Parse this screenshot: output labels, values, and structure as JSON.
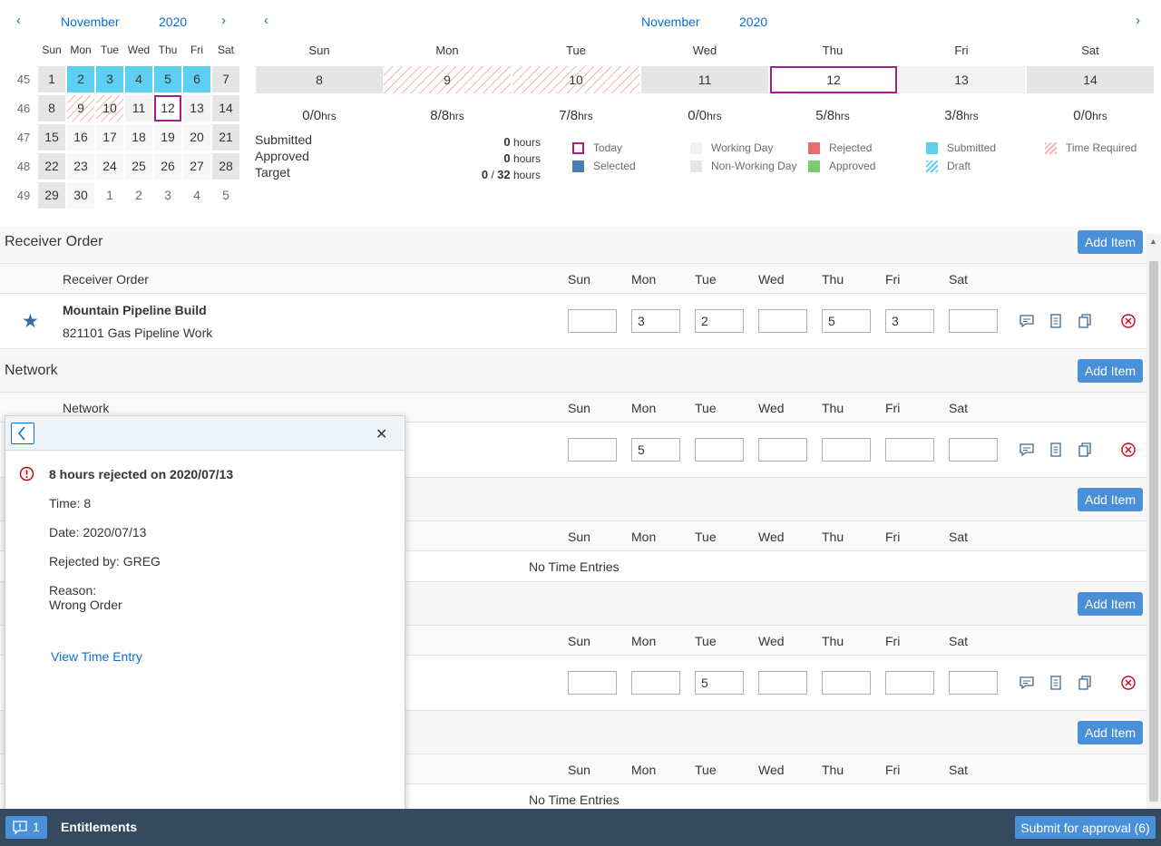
{
  "mini_calendar": {
    "month": "November",
    "year": "2020",
    "weekdays": [
      "Sun",
      "Mon",
      "Tue",
      "Wed",
      "Thu",
      "Fri",
      "Sat"
    ],
    "weeks": [
      {
        "wk": "45",
        "days": [
          "1",
          "2",
          "3",
          "4",
          "5",
          "6",
          "7"
        ]
      },
      {
        "wk": "46",
        "days": [
          "8",
          "9",
          "10",
          "11",
          "12",
          "13",
          "14"
        ]
      },
      {
        "wk": "47",
        "days": [
          "15",
          "16",
          "17",
          "18",
          "19",
          "20",
          "21"
        ]
      },
      {
        "wk": "48",
        "days": [
          "22",
          "23",
          "24",
          "25",
          "26",
          "27",
          "28"
        ]
      },
      {
        "wk": "49",
        "days": [
          "29",
          "30",
          "1",
          "2",
          "3",
          "4",
          "5"
        ]
      }
    ]
  },
  "week_view": {
    "month": "November",
    "year": "2020",
    "days": [
      {
        "dow": "Sun",
        "date": "8",
        "hrs": "0/0"
      },
      {
        "dow": "Mon",
        "date": "9",
        "hrs": "8/8"
      },
      {
        "dow": "Tue",
        "date": "10",
        "hrs": "7/8"
      },
      {
        "dow": "Wed",
        "date": "11",
        "hrs": "0/0"
      },
      {
        "dow": "Thu",
        "date": "12",
        "hrs": "5/8"
      },
      {
        "dow": "Fri",
        "date": "13",
        "hrs": "3/8"
      },
      {
        "dow": "Sat",
        "date": "14",
        "hrs": "0/0"
      }
    ],
    "hrs_unit": "hrs"
  },
  "summary": {
    "submitted_label": "Submitted",
    "submitted_value": "0",
    "submitted_unit": "hours",
    "approved_label": "Approved",
    "approved_value": "0",
    "approved_unit": "hours",
    "target_label": "Target",
    "target_value": "0",
    "target_sep": " / ",
    "target_total": "32",
    "target_unit": "hours"
  },
  "legend": {
    "today": "Today",
    "selected": "Selected",
    "working_day": "Working Day",
    "non_working_day": "Non-Working Day",
    "rejected": "Rejected",
    "approved": "Approved",
    "submitted": "Submitted",
    "draft": "Draft",
    "time_required": "Time Required"
  },
  "colors": {
    "today": "#a4208a",
    "selected": "#4a7fb5",
    "rejected": "#ea6d6d",
    "approved": "#7fc96f",
    "submitted": "#5dcff0",
    "accent": "#0a6ed1",
    "shell": "#354a5f"
  },
  "table_days": [
    "Sun",
    "Mon",
    "Tue",
    "Wed",
    "Thu",
    "Fri",
    "Sat"
  ],
  "add_item_label": "Add Item",
  "no_entries": "No Time Entries",
  "sections": {
    "receiver_order": {
      "title": "Receiver Order",
      "header": "Receiver Order",
      "row_title": "Mountain Pipeline Build",
      "row_subtitle": "821101 Gas Pipeline Work",
      "values": [
        "",
        "3",
        "2",
        "",
        "5",
        "3",
        ""
      ]
    },
    "network": {
      "title": "Network",
      "header": "Network",
      "values": [
        "",
        "5",
        "",
        "",
        "",
        "",
        ""
      ]
    },
    "section3": {
      "values": []
    },
    "section4": {
      "values": [
        "",
        "",
        "5",
        "",
        "",
        "",
        ""
      ]
    }
  },
  "popover": {
    "title": "8 hours rejected on 2020/07/13",
    "time": "Time: 8",
    "date": "Date: 2020/07/13",
    "rejected_by": "Rejected by: GREG",
    "reason_label": "Reason:",
    "reason": "Wrong Order",
    "link": "View Time Entry"
  },
  "footer": {
    "messages_count": "1",
    "entitlements": "Entitlements",
    "submit": "Submit for approval (6)"
  }
}
